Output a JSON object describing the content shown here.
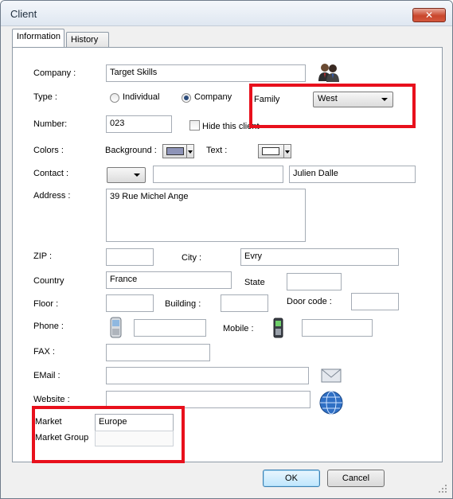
{
  "window": {
    "title": "Client",
    "close": "✕"
  },
  "tabs": [
    {
      "label": "Information"
    },
    {
      "label": "History"
    }
  ],
  "form": {
    "company_label": "Company :",
    "company_value": "Target Skills",
    "type_label": "Type :",
    "type_individual": "Individual",
    "type_company": "Company",
    "family_label": "Family",
    "family_value": "West",
    "number_label": "Number:",
    "number_value": "023",
    "hide_client": "Hide this client",
    "colors_label": "Colors :",
    "background_label": "Background :",
    "text_label": "Text :",
    "background_color": "#8e94b8",
    "text_color": "#ffffff",
    "contact_label": "Contact :",
    "contact_name": "Julien Dalle",
    "address_label": "Address :",
    "address_value": "39 Rue Michel Ange",
    "zip_label": "ZIP :",
    "city_label": "City :",
    "city_value": "Evry",
    "country_label": "Country",
    "country_value": "France",
    "state_label": "State",
    "floor_label": "Floor :",
    "building_label": "Building :",
    "doorcode_label": "Door code :",
    "phone_label": "Phone :",
    "mobile_label": "Mobile :",
    "fax_label": "FAX :",
    "email_label": "EMail :",
    "website_label": "Website :",
    "market_label": "Market",
    "market_value": "Europe",
    "market_group_label": "Market Group"
  },
  "buttons": {
    "ok": "OK",
    "cancel": "Cancel"
  },
  "colors": {
    "highlight": "#e8101c"
  }
}
